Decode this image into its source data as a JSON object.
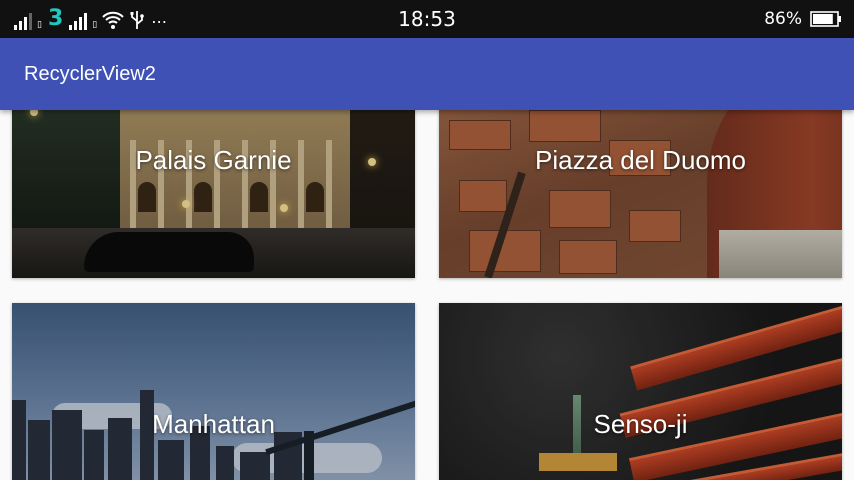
{
  "status_bar": {
    "carrier": "3",
    "more": "⋯",
    "time": "18:53",
    "battery": "86%",
    "battery_level": 0.86,
    "icons": [
      "signal-icon",
      "sim-icon",
      "wifi-icon",
      "usb-icon",
      "battery-icon"
    ]
  },
  "app_bar": {
    "title": "RecyclerView2"
  },
  "cards": [
    {
      "title": "Palais Garnie"
    },
    {
      "title": "Piazza del Duomo"
    },
    {
      "title": "Manhattan"
    },
    {
      "title": "Senso-ji"
    }
  ],
  "colors": {
    "status_bar": "#111111",
    "app_bar": "#3f51b5",
    "background": "#fafafa",
    "carrier_accent": "#1fc7c0"
  }
}
